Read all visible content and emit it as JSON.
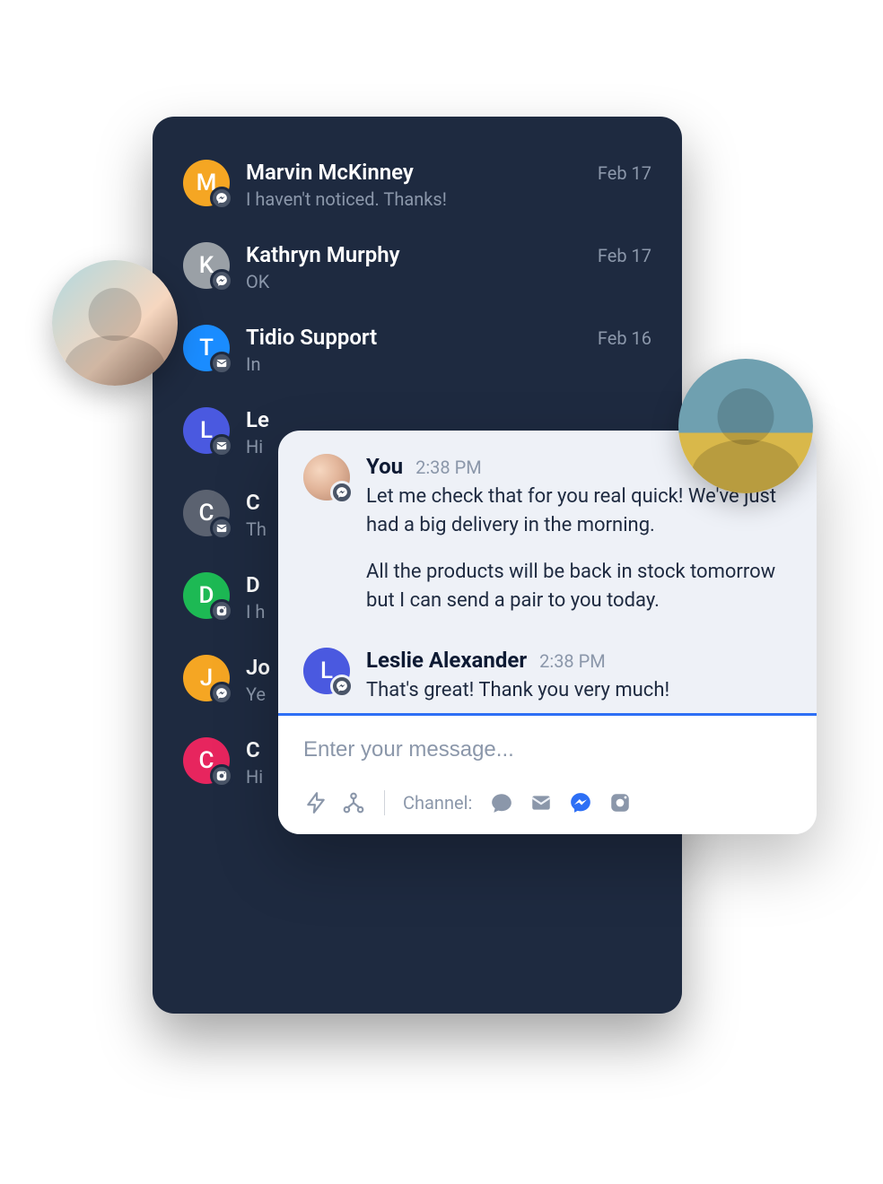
{
  "conversations": [
    {
      "initial": "M",
      "name": "Marvin McKinney",
      "preview": "I haven't noticed. Thanks!",
      "date": "Feb 17",
      "color": "c-orange",
      "badge": "messenger"
    },
    {
      "initial": "K",
      "name": "Kathryn Murphy",
      "preview": "OK",
      "date": "Feb 17",
      "color": "c-grey",
      "badge": "messenger"
    },
    {
      "initial": "T",
      "name": "Tidio Support",
      "preview": "In",
      "date": "Feb 16",
      "color": "c-blue",
      "badge": "mail"
    },
    {
      "initial": "L",
      "name": "Le",
      "preview": "Hi",
      "date": "",
      "color": "c-indigo",
      "badge": "mail"
    },
    {
      "initial": "C",
      "name": "C",
      "preview": "Th",
      "date": "",
      "color": "c-dgrey",
      "badge": "mail"
    },
    {
      "initial": "D",
      "name": "D",
      "preview": "I h",
      "date": "",
      "color": "c-green",
      "badge": "instagram"
    },
    {
      "initial": "J",
      "name": "Jo",
      "preview": "Ye",
      "date": "",
      "color": "c-amber",
      "badge": "messenger"
    },
    {
      "initial": "C",
      "name": "C",
      "preview": "Hi",
      "date": "",
      "color": "c-pink",
      "badge": "instagram"
    }
  ],
  "chat": {
    "messages": [
      {
        "sender": "You",
        "time": "2:38 PM",
        "paragraphs": [
          "Let me check that for you real quick! We've just had a big delivery in the morning.",
          "All the products will be back in stock tomorrow but I can send a pair to you today."
        ],
        "avatar": "photo",
        "badge": "messenger"
      },
      {
        "sender": "Leslie Alexander",
        "time": "2:38 PM",
        "paragraphs": [
          "That's great! Thank you very much!"
        ],
        "avatar": "initial",
        "initial": "L",
        "color": "c-indigo",
        "badge": "messenger"
      }
    ],
    "composer": {
      "placeholder": "Enter your message...",
      "channel_label": "Channel:"
    }
  }
}
